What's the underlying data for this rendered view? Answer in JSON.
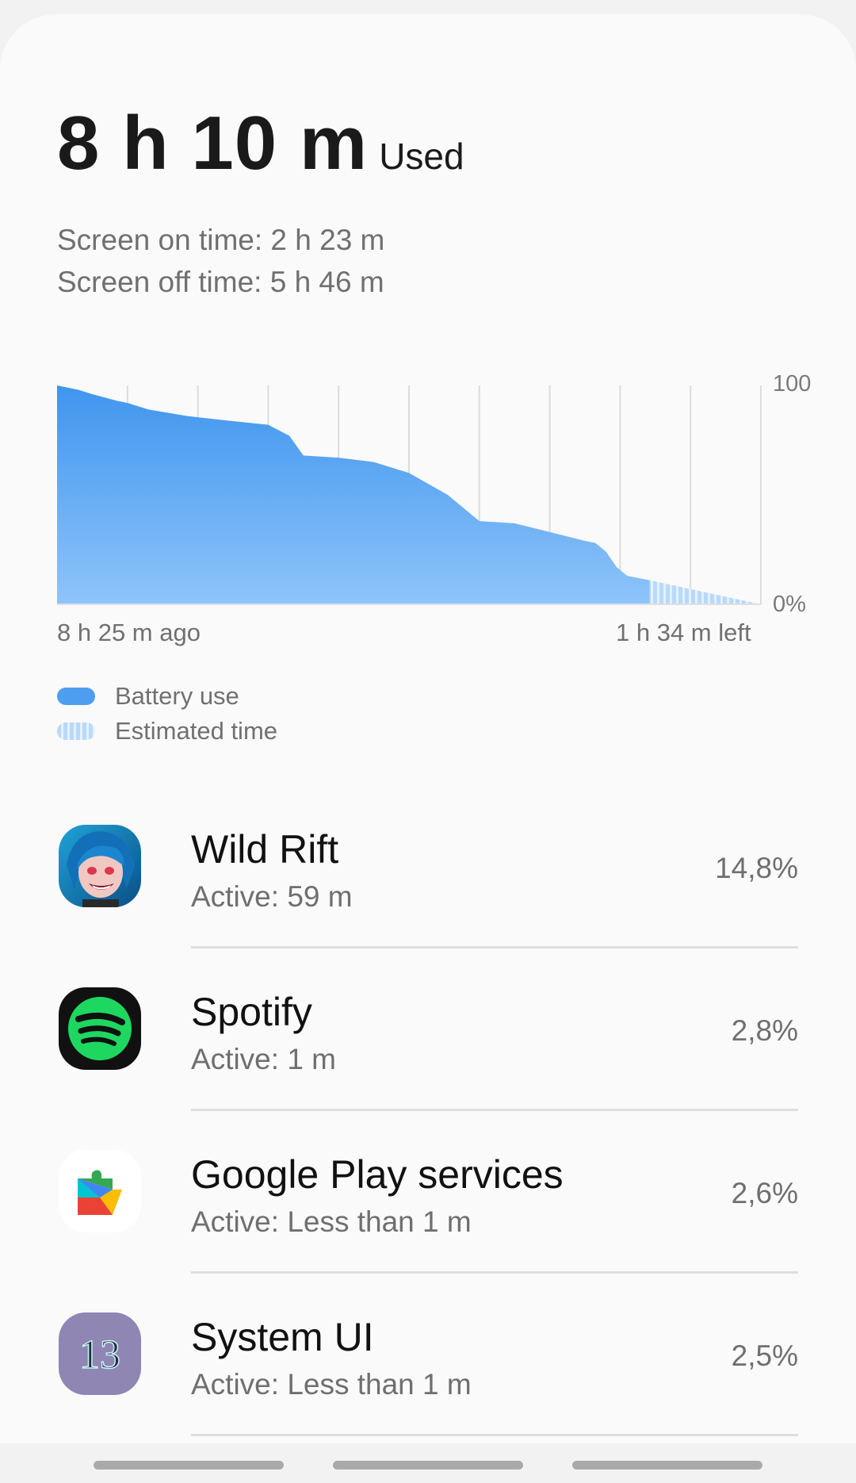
{
  "summary": {
    "used_value": "8 h 10 m",
    "used_label": "Used",
    "screen_on": "Screen on time: 2 h 23 m",
    "screen_off": "Screen off time: 5 h 46 m"
  },
  "chart_data": {
    "type": "area",
    "y_max_label": "100",
    "y_min_label": "0%",
    "x_start_label": "8 h 25 m ago",
    "x_end_label": "1 h 34 m left",
    "ylim": [
      0,
      100
    ],
    "grid": "vertical",
    "total_hours": 10,
    "series": [
      {
        "name": "Battery use",
        "color": "#4d9ef0",
        "x": [
          0,
          0.3,
          0.5,
          0.85,
          1.0,
          1.3,
          1.85,
          2.4,
          3.0,
          3.3,
          3.5,
          4.0,
          4.5,
          5.0,
          5.55,
          6.0,
          6.5,
          7.0,
          7.5,
          7.65,
          7.8,
          7.95,
          8.1,
          8.42
        ],
        "y": [
          100,
          98,
          96,
          93,
          92,
          89,
          86,
          84,
          82,
          77,
          68,
          67,
          65,
          60,
          50,
          38,
          37,
          33,
          29,
          28,
          24,
          17,
          13,
          11
        ]
      },
      {
        "name": "Estimated time",
        "color": "#b9d9f9",
        "x": [
          8.42,
          10.0
        ],
        "y": [
          11,
          0
        ]
      }
    ]
  },
  "legend": {
    "battery_use": "Battery use",
    "estimated_time": "Estimated time"
  },
  "apps": [
    {
      "name": "Wild Rift",
      "active": "Active: 59 m",
      "percent": "14,8%",
      "icon": "wild-rift-icon"
    },
    {
      "name": "Spotify",
      "active": "Active: 1 m",
      "percent": "2,8%",
      "icon": "spotify-icon"
    },
    {
      "name": "Google Play services",
      "active": "Active: Less than 1 m",
      "percent": "2,6%",
      "icon": "google-play-services-icon"
    },
    {
      "name": "System UI",
      "active": "Active: Less than 1 m",
      "percent": "2,5%",
      "icon": "system-ui-icon",
      "icon_text": "13"
    }
  ]
}
